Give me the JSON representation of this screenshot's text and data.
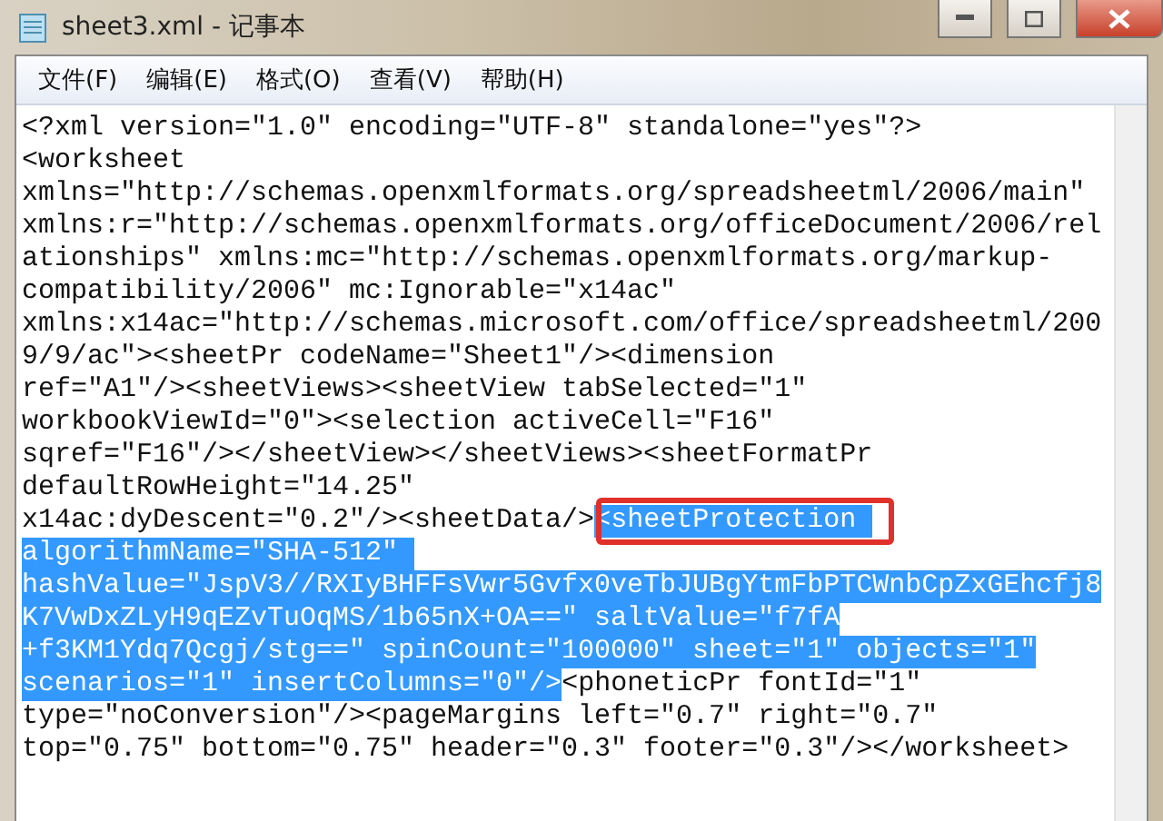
{
  "window": {
    "title": "sheet3.xml - 记事本"
  },
  "menu": [
    {
      "label": "文件(F)"
    },
    {
      "label": "编辑(E)"
    },
    {
      "label": "格式(O)"
    },
    {
      "label": "查看(V)"
    },
    {
      "label": "帮助(H)"
    }
  ],
  "lines": [
    [
      {
        "text": "<?xml version=\"1.0\" encoding=\"UTF-8\" standalone=\"yes\"?>",
        "selected": false
      }
    ],
    [
      {
        "text": "<worksheet",
        "selected": false
      }
    ],
    [
      {
        "text": "xmlns=\"http://schemas.openxmlformats.org/spreadsheetml/2006/main\"",
        "selected": false
      }
    ],
    [
      {
        "text": "xmlns:r=\"http://schemas.openxmlformats.org/officeDocument/2006/rel",
        "selected": false
      }
    ],
    [
      {
        "text": "ationships\" xmlns:mc=\"http://schemas.openxmlformats.org/markup-",
        "selected": false
      }
    ],
    [
      {
        "text": "compatibility/2006\" mc:Ignorable=\"x14ac\"",
        "selected": false
      }
    ],
    [
      {
        "text": "xmlns:x14ac=\"http://schemas.microsoft.com/office/spreadsheetml/200",
        "selected": false
      }
    ],
    [
      {
        "text": "9/9/ac\"><sheetPr codeName=\"Sheet1\"/><dimension",
        "selected": false
      }
    ],
    [
      {
        "text": "ref=\"A1\"/><sheetViews><sheetView tabSelected=\"1\"",
        "selected": false
      }
    ],
    [
      {
        "text": "workbookViewId=\"0\"><selection activeCell=\"F16\"",
        "selected": false
      }
    ],
    [
      {
        "text": "sqref=\"F16\"/></sheetView></sheetViews><sheetFormatPr",
        "selected": false
      }
    ],
    [
      {
        "text": "defaultRowHeight=\"14.25\"",
        "selected": false
      }
    ],
    [
      {
        "text": "x14ac:dyDescent=\"0.2\"/><sheetData/>",
        "selected": false
      },
      {
        "text": "<sheetProtection ",
        "selected": true,
        "annotated": true
      }
    ],
    [
      {
        "text": "algorithmName=\"SHA-512\" ",
        "selected": true
      }
    ],
    [
      {
        "text": "hashValue=\"JspV3//RXIyBHFFsVwr5Gvfx0veTbJUBgYtmFbPTCWnbCpZxGEhcfj8",
        "selected": true
      }
    ],
    [
      {
        "text": "K7VwDxZLyH9qEZvTuOqMS/1b65nX+OA==\" saltValue=\"f7fA",
        "selected": true
      }
    ],
    [
      {
        "text": "+f3KM1Ydq7Qcgj/stg==\" spinCount=\"100000\" sheet=\"1\" objects=\"1\"",
        "selected": true
      }
    ],
    [
      {
        "text": "scenarios=\"1\" insertColumns=\"0\"/>",
        "selected": true
      },
      {
        "text": "<phoneticPr fontId=\"1\"",
        "selected": false
      }
    ],
    [
      {
        "text": "type=\"noConversion\"/><pageMargins left=\"0.7\" right=\"0.7\"",
        "selected": false
      }
    ],
    [
      {
        "text": "top=\"0.75\" bottom=\"0.75\" header=\"0.3\" footer=\"0.3\"/></worksheet>",
        "selected": false
      }
    ]
  ]
}
